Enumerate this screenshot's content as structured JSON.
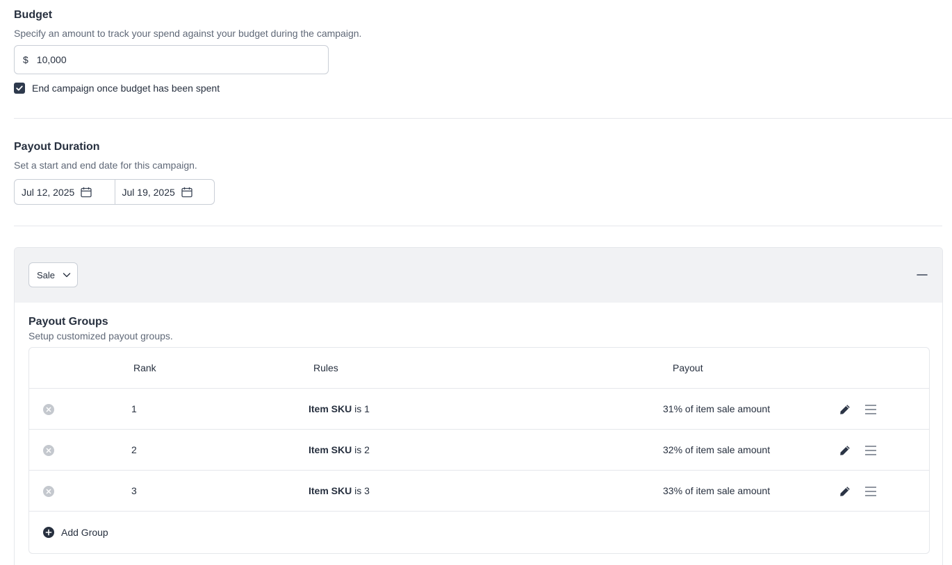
{
  "budget": {
    "title": "Budget",
    "description": "Specify an amount to track your spend against your budget during the campaign.",
    "currency_symbol": "$",
    "amount": "10,000",
    "end_when_spent_label": "End campaign once budget has been spent",
    "end_when_spent_checked": true
  },
  "payout_duration": {
    "title": "Payout Duration",
    "description": "Set a start and end date for this campaign.",
    "start_date": "Jul 12, 2025",
    "end_date": "Jul 19, 2025"
  },
  "event_panel": {
    "event_type": "Sale",
    "collapse_icon": "minus-icon"
  },
  "payout_groups": {
    "title": "Payout Groups",
    "description": "Setup customized payout groups.",
    "columns": {
      "rank": "Rank",
      "rules": "Rules",
      "payout": "Payout"
    },
    "rows": [
      {
        "rank": "1",
        "rule_field": "Item SKU",
        "rule_operator": "is 1",
        "payout": "31% of item sale amount"
      },
      {
        "rank": "2",
        "rule_field": "Item SKU",
        "rule_operator": "is 2",
        "payout": "32% of item sale amount"
      },
      {
        "rank": "3",
        "rule_field": "Item SKU",
        "rule_operator": "is 3",
        "payout": "33% of item sale amount"
      }
    ],
    "add_group_label": "Add Group"
  },
  "colors": {
    "text_primary": "#27303f",
    "text_secondary": "#5f6877",
    "accent_dark": "#2e3a4d",
    "panel_header_bg": "#f1f2f4",
    "border": "#e5e7eb",
    "remove_icon": "#c4c8ce"
  }
}
